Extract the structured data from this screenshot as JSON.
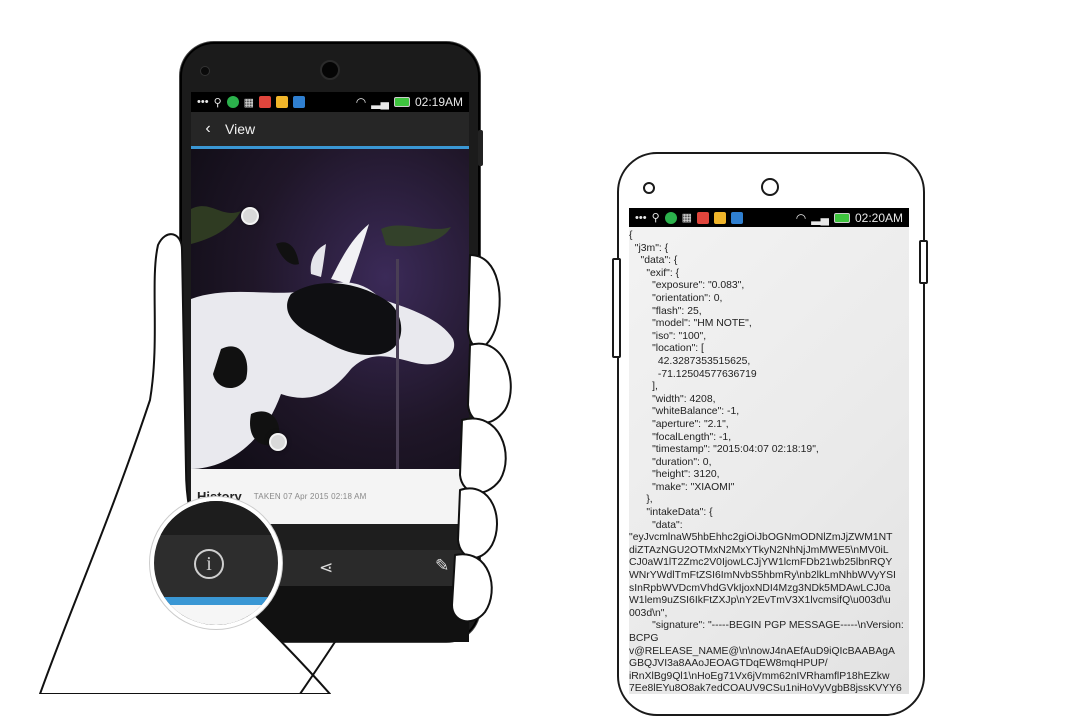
{
  "left_phone": {
    "status_time": "02:19AM",
    "appbar": {
      "back_icon": "chevron-left-icon",
      "title": "View"
    },
    "history": {
      "title": "History",
      "taken": "TAKEN 07 Apr 2015 02:18 AM"
    },
    "bottom_icons": [
      "info-icon",
      "share-icon",
      "edit-icon"
    ]
  },
  "right_phone": {
    "status_time": "02:20AM",
    "json_lines": [
      "{",
      "  \"j3m\": {",
      "    \"data\": {",
      "      \"exif\": {",
      "        \"exposure\": \"0.083\",",
      "        \"orientation\": 0,",
      "        \"flash\": 25,",
      "        \"model\": \"HM NOTE\",",
      "        \"iso\": \"100\",",
      "        \"location\": [",
      "          42.3287353515625,",
      "          -71.12504577636719",
      "        ],",
      "        \"width\": 4208,",
      "        \"whiteBalance\": -1,",
      "        \"aperture\": \"2.1\",",
      "        \"focalLength\": -1,",
      "        \"timestamp\": \"2015:04:07 02:18:19\",",
      "        \"duration\": 0,",
      "        \"height\": 3120,",
      "        \"make\": \"XIAOMI\"",
      "      },",
      "      \"intakeData\": {",
      "        \"data\":",
      "\"eyJvcmlnaW5hbEhhc2giOiJbOGNmODNlZmJjZWM1NT",
      "diZTAzNGU2OTMxN2MxYTkyN2NhNjJmMWE5\\nMV0iL",
      "CJ0aW1lT2Zmc2V0IjowLCJjYW1lcmFDb21wb25lbnRQY",
      "WNrYWdlTmFtZSI6ImNvbS5hbmRy\\nb2lkLmNhbWVyYSI",
      "sInRpbWVDcmVhdGVkIjoxNDI4Mzg3NDk5MDAwLCJ0a",
      "W1lem9uZSI6IkFtZXJp\\nY2EvTmV3X1lvcmsifQ\\u003d\\u",
      "003d\\n\",",
      "        \"signature\": \"-----BEGIN PGP MESSAGE-----\\nVersion:",
      "BCPG",
      "v@RELEASE_NAME@\\n\\nowJ4nAEfAuD9iQIcBAABAgA",
      "GBQJVI3a8AAoJEOAGTDqEW8mqHPUP/",
      "iRnXlBg9Ql1\\nHoEg71Vx6jVmm62nIVRhamflP18hEZkw",
      "7Ee8lEYu8O8ak7edCOAUV9CSu1niHoVyVgbB8jssKVYY6"
    ]
  }
}
